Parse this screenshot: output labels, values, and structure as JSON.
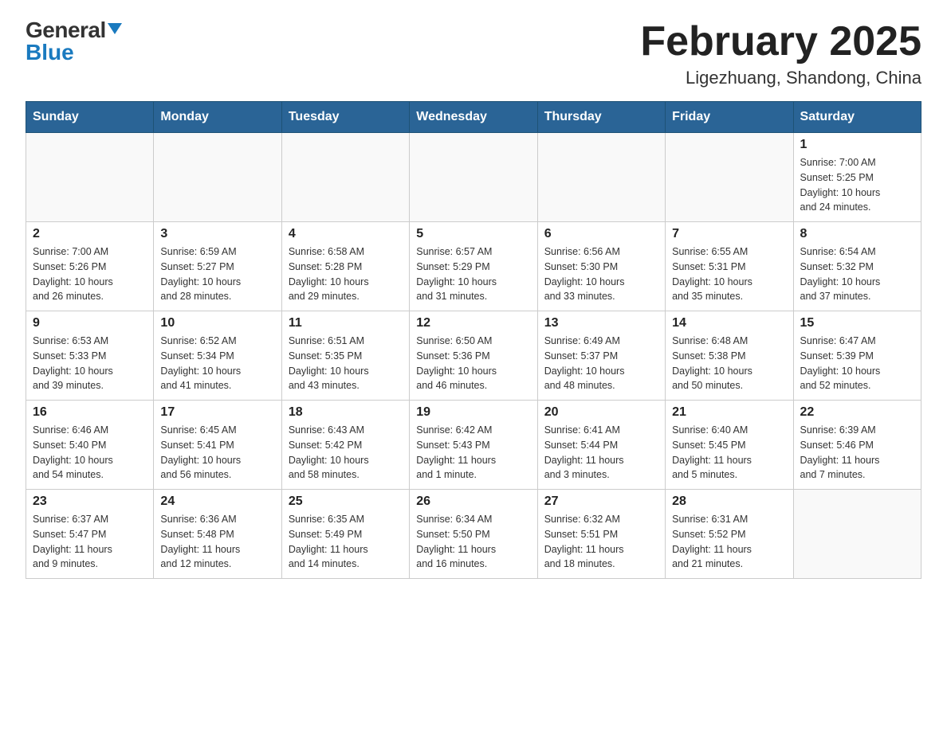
{
  "logo": {
    "general": "General",
    "blue": "Blue",
    "triangle": "▲"
  },
  "title": "February 2025",
  "subtitle": "Ligezhuang, Shandong, China",
  "days_of_week": [
    "Sunday",
    "Monday",
    "Tuesday",
    "Wednesday",
    "Thursday",
    "Friday",
    "Saturday"
  ],
  "weeks": [
    [
      {
        "day": "",
        "info": ""
      },
      {
        "day": "",
        "info": ""
      },
      {
        "day": "",
        "info": ""
      },
      {
        "day": "",
        "info": ""
      },
      {
        "day": "",
        "info": ""
      },
      {
        "day": "",
        "info": ""
      },
      {
        "day": "1",
        "info": "Sunrise: 7:00 AM\nSunset: 5:25 PM\nDaylight: 10 hours\nand 24 minutes."
      }
    ],
    [
      {
        "day": "2",
        "info": "Sunrise: 7:00 AM\nSunset: 5:26 PM\nDaylight: 10 hours\nand 26 minutes."
      },
      {
        "day": "3",
        "info": "Sunrise: 6:59 AM\nSunset: 5:27 PM\nDaylight: 10 hours\nand 28 minutes."
      },
      {
        "day": "4",
        "info": "Sunrise: 6:58 AM\nSunset: 5:28 PM\nDaylight: 10 hours\nand 29 minutes."
      },
      {
        "day": "5",
        "info": "Sunrise: 6:57 AM\nSunset: 5:29 PM\nDaylight: 10 hours\nand 31 minutes."
      },
      {
        "day": "6",
        "info": "Sunrise: 6:56 AM\nSunset: 5:30 PM\nDaylight: 10 hours\nand 33 minutes."
      },
      {
        "day": "7",
        "info": "Sunrise: 6:55 AM\nSunset: 5:31 PM\nDaylight: 10 hours\nand 35 minutes."
      },
      {
        "day": "8",
        "info": "Sunrise: 6:54 AM\nSunset: 5:32 PM\nDaylight: 10 hours\nand 37 minutes."
      }
    ],
    [
      {
        "day": "9",
        "info": "Sunrise: 6:53 AM\nSunset: 5:33 PM\nDaylight: 10 hours\nand 39 minutes."
      },
      {
        "day": "10",
        "info": "Sunrise: 6:52 AM\nSunset: 5:34 PM\nDaylight: 10 hours\nand 41 minutes."
      },
      {
        "day": "11",
        "info": "Sunrise: 6:51 AM\nSunset: 5:35 PM\nDaylight: 10 hours\nand 43 minutes."
      },
      {
        "day": "12",
        "info": "Sunrise: 6:50 AM\nSunset: 5:36 PM\nDaylight: 10 hours\nand 46 minutes."
      },
      {
        "day": "13",
        "info": "Sunrise: 6:49 AM\nSunset: 5:37 PM\nDaylight: 10 hours\nand 48 minutes."
      },
      {
        "day": "14",
        "info": "Sunrise: 6:48 AM\nSunset: 5:38 PM\nDaylight: 10 hours\nand 50 minutes."
      },
      {
        "day": "15",
        "info": "Sunrise: 6:47 AM\nSunset: 5:39 PM\nDaylight: 10 hours\nand 52 minutes."
      }
    ],
    [
      {
        "day": "16",
        "info": "Sunrise: 6:46 AM\nSunset: 5:40 PM\nDaylight: 10 hours\nand 54 minutes."
      },
      {
        "day": "17",
        "info": "Sunrise: 6:45 AM\nSunset: 5:41 PM\nDaylight: 10 hours\nand 56 minutes."
      },
      {
        "day": "18",
        "info": "Sunrise: 6:43 AM\nSunset: 5:42 PM\nDaylight: 10 hours\nand 58 minutes."
      },
      {
        "day": "19",
        "info": "Sunrise: 6:42 AM\nSunset: 5:43 PM\nDaylight: 11 hours\nand 1 minute."
      },
      {
        "day": "20",
        "info": "Sunrise: 6:41 AM\nSunset: 5:44 PM\nDaylight: 11 hours\nand 3 minutes."
      },
      {
        "day": "21",
        "info": "Sunrise: 6:40 AM\nSunset: 5:45 PM\nDaylight: 11 hours\nand 5 minutes."
      },
      {
        "day": "22",
        "info": "Sunrise: 6:39 AM\nSunset: 5:46 PM\nDaylight: 11 hours\nand 7 minutes."
      }
    ],
    [
      {
        "day": "23",
        "info": "Sunrise: 6:37 AM\nSunset: 5:47 PM\nDaylight: 11 hours\nand 9 minutes."
      },
      {
        "day": "24",
        "info": "Sunrise: 6:36 AM\nSunset: 5:48 PM\nDaylight: 11 hours\nand 12 minutes."
      },
      {
        "day": "25",
        "info": "Sunrise: 6:35 AM\nSunset: 5:49 PM\nDaylight: 11 hours\nand 14 minutes."
      },
      {
        "day": "26",
        "info": "Sunrise: 6:34 AM\nSunset: 5:50 PM\nDaylight: 11 hours\nand 16 minutes."
      },
      {
        "day": "27",
        "info": "Sunrise: 6:32 AM\nSunset: 5:51 PM\nDaylight: 11 hours\nand 18 minutes."
      },
      {
        "day": "28",
        "info": "Sunrise: 6:31 AM\nSunset: 5:52 PM\nDaylight: 11 hours\nand 21 minutes."
      },
      {
        "day": "",
        "info": ""
      }
    ]
  ]
}
